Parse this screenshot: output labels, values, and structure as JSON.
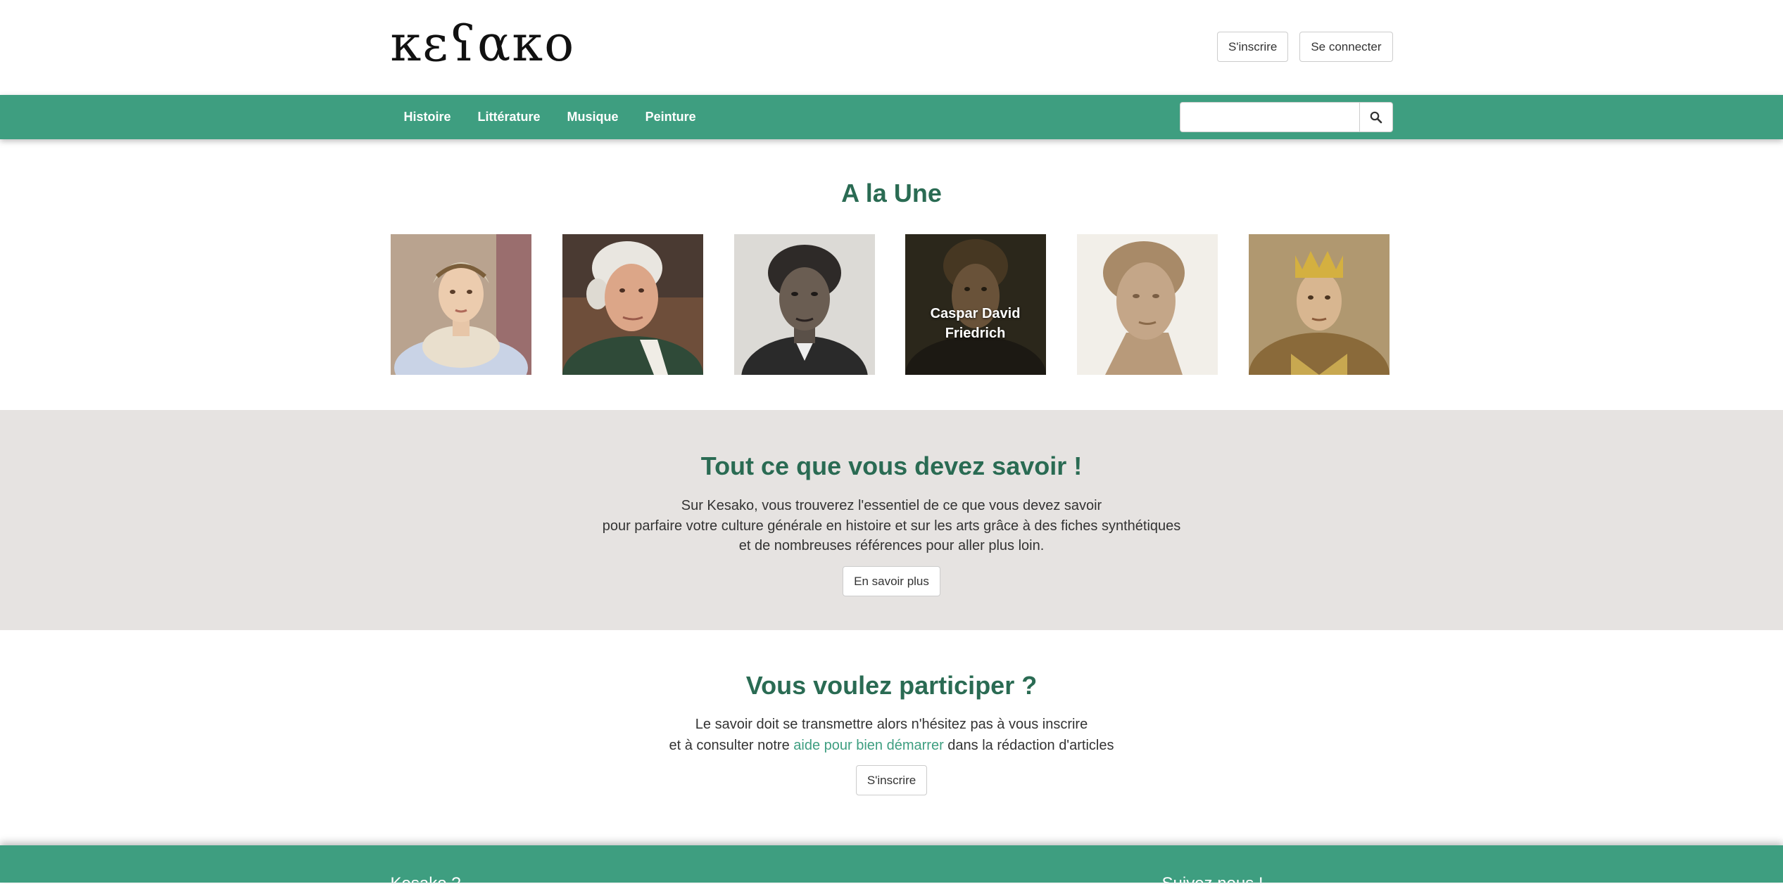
{
  "header": {
    "logo_text": "κεʕακο",
    "signup_label": "S'inscrire",
    "login_label": "Se connecter"
  },
  "nav": {
    "items": [
      {
        "label": "Histoire"
      },
      {
        "label": "Littérature"
      },
      {
        "label": "Musique"
      },
      {
        "label": "Peinture"
      }
    ],
    "search": {
      "placeholder": "",
      "value": "",
      "icon": "search-icon"
    }
  },
  "une": {
    "title": "A la Une",
    "cards": [
      {
        "label": "",
        "image": "portrait-woman-bonnet"
      },
      {
        "label": "",
        "image": "portrait-man-white-wig"
      },
      {
        "label": "",
        "image": "portrait-man-curly-hair"
      },
      {
        "label": "Caspar David Friedrich",
        "image": "portrait-dark-painting"
      },
      {
        "label": "",
        "image": "marble-bust"
      },
      {
        "label": "",
        "image": "portrait-king-crown"
      }
    ]
  },
  "savoir": {
    "title": "Tout ce que vous devez savoir !",
    "lines": [
      "Sur Kesako, vous trouverez l'essentiel de ce que vous devez savoir",
      "pour parfaire votre culture générale en histoire et sur les arts grâce à des fiches synthétiques",
      "et de nombreuses références pour aller plus loin."
    ],
    "button_label": "En savoir plus"
  },
  "participer": {
    "title": "Vous voulez participer ?",
    "line1": "Le savoir doit se transmettre alors n'hésitez pas à vous inscrire",
    "line2_before": "et à consulter notre ",
    "line2_link": "aide pour bien démarrer",
    "line2_after": " dans la rédaction d'articles",
    "button_label": "S'inscrire"
  },
  "footer": {
    "left_title": "Kesako ?",
    "right_title": "Suivez nous !"
  },
  "colors": {
    "accent": "#3e9e80",
    "heading": "#2a6b53",
    "band": "#e6e3e1"
  }
}
